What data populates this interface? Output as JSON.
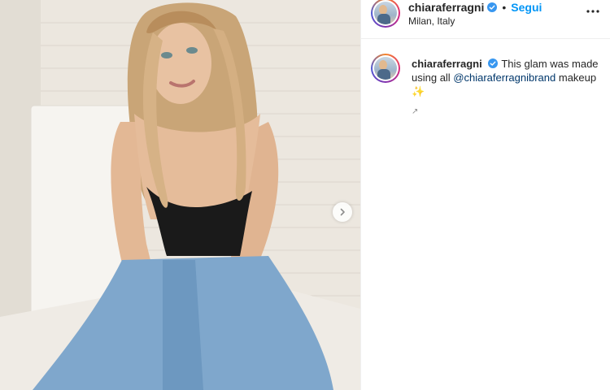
{
  "post": {
    "username": "chiaraferragni",
    "verified": true,
    "separator": "•",
    "follow_label": "Segui",
    "location": "Milan, Italy",
    "more_icon": "more-horizontal-icon",
    "carousel_icon": "chevron-right-icon",
    "caption": {
      "username": "chiaraferragni",
      "text_before": "This glam was made using all ",
      "mention": "@chiaraferragnibrand",
      "text_after": " makeup",
      "emoji": "✨",
      "extra": "↗"
    }
  },
  "colors": {
    "accent": "#0095f6",
    "mention": "#00376b",
    "verified": "#3897f0",
    "text": "#262626",
    "border": "#efefef"
  }
}
